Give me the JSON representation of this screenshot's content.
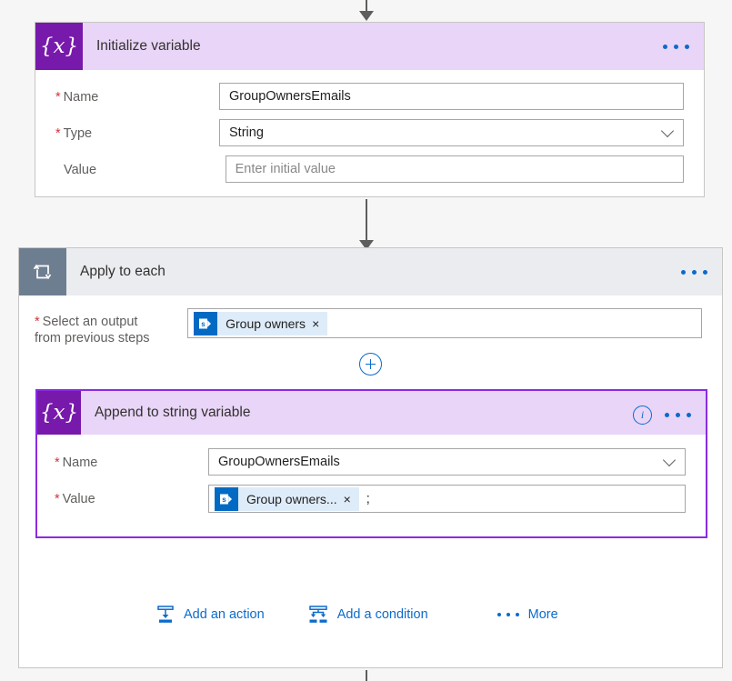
{
  "flow": {
    "top_connector": "arrow-down-icon",
    "bottom_connector": "connector-line"
  },
  "initialize_variable": {
    "title": "Initialize variable",
    "icon": "variable-braces-icon",
    "menu": "ellipsis-menu-icon",
    "fields": [
      {
        "label": "Name",
        "required": true,
        "value": "GroupOwnersEmails",
        "type": "text"
      },
      {
        "label": "Type",
        "required": true,
        "value": "String",
        "type": "dropdown"
      },
      {
        "label": "Value",
        "required": false,
        "value": "",
        "placeholder": "Enter initial value",
        "type": "text"
      }
    ]
  },
  "apply_to_each": {
    "title": "Apply to each",
    "icon": "loop-repeat-icon",
    "menu": "ellipsis-menu-icon",
    "output_field": {
      "label_line1": "Select an output",
      "label_line2": "from previous steps",
      "required": true,
      "token": {
        "label": "Group owners",
        "icon": "sharepoint-icon",
        "remove": "×"
      }
    },
    "add_step_button": "plus-icon",
    "append_card": {
      "title": "Append to string variable",
      "icon": "variable-braces-icon",
      "info": "i",
      "menu": "ellipsis-menu-icon",
      "fields": {
        "name": {
          "label": "Name",
          "required": true,
          "value": "GroupOwnersEmails"
        },
        "value": {
          "label": "Value",
          "required": true,
          "token": {
            "label": "Group owners...",
            "icon": "sharepoint-icon",
            "remove": "×"
          },
          "trailing_text": ";"
        }
      }
    },
    "footer": {
      "add_action": {
        "label": "Add an action",
        "icon": "add-action-icon"
      },
      "add_condition": {
        "label": "Add a condition",
        "icon": "add-condition-icon"
      },
      "more": {
        "label": "More",
        "icon": "more-dots-icon"
      }
    }
  },
  "colors": {
    "variable_purple": "#7719aa",
    "lavender_header": "#e9d5f7",
    "loop_slate": "#6e7e91",
    "accent_blue": "#0b6bcb",
    "selection_purple": "#8a2be2",
    "required_red": "#d13438",
    "chip_blue": "#deecf9"
  }
}
